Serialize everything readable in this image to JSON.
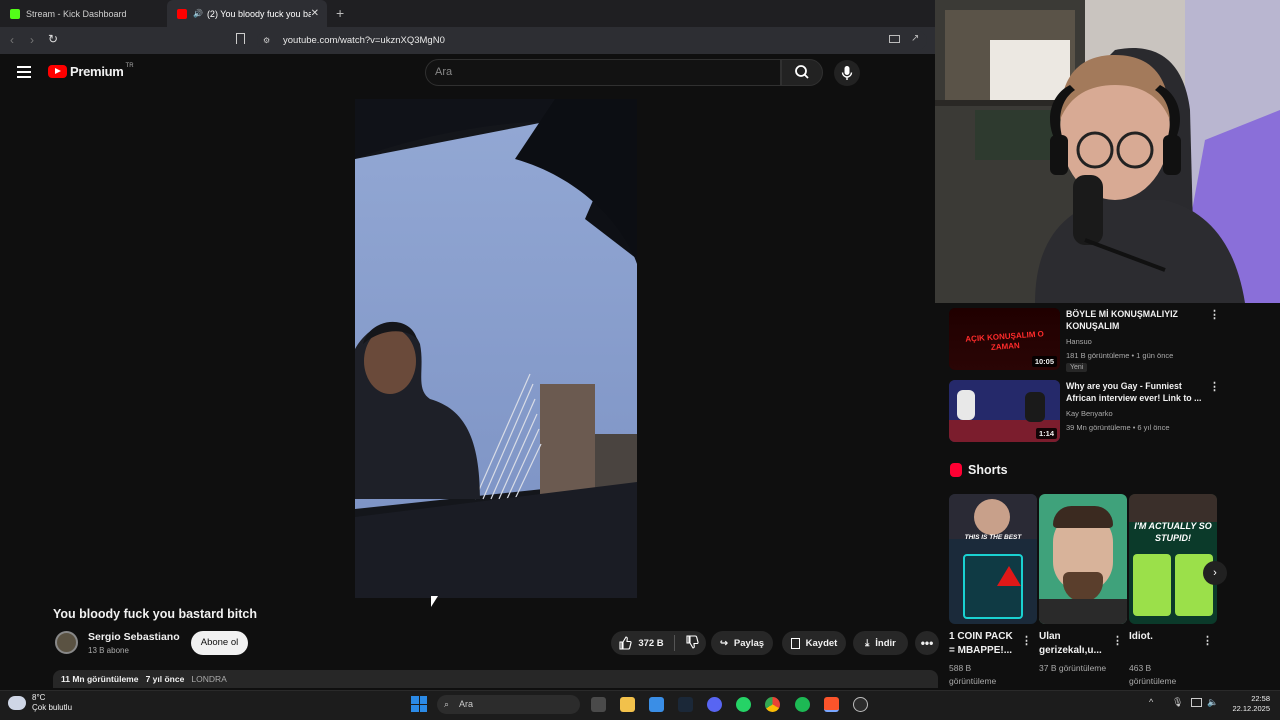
{
  "browser": {
    "tabs": [
      {
        "label": "Stream - Kick Dashboard"
      },
      {
        "label": "(2) You bloody fuck you basta"
      }
    ],
    "url": "youtube.com/watch?v=ukznXQ3MgN0"
  },
  "header": {
    "logo_text": "Premium",
    "region": "TR",
    "search_placeholder": "Ara"
  },
  "video": {
    "title": "You bloody fuck you bastard bitch",
    "channel_name": "Sergio Sebastiano",
    "subscribers": "13 B abone",
    "subscribe_label": "Abone ol",
    "likes": "372 B",
    "share_label": "Paylaş",
    "save_label": "Kaydet",
    "download_label": "İndir",
    "views": "11 Mn görüntüleme",
    "age": "7 yıl önce",
    "location": "LONDRA"
  },
  "recommendations": [
    {
      "title": "BÖYLE Mİ KONUŞMALIYIZ KONUŞALIM",
      "channel": "Hansuo",
      "meta": "181 B görüntüleme • 1 gün önce",
      "duration": "10:05",
      "badge": "Yeni",
      "thumb_text": "AÇIK KONUŞALIM O ZAMAN"
    },
    {
      "title": "Why are you Gay - Funniest African interview ever! Link to ...",
      "channel": "Kay Benyarko",
      "meta": "39 Mn görüntüleme • 6 yıl önce",
      "duration": "1:14"
    }
  ],
  "shorts": {
    "heading": "Shorts",
    "items": [
      {
        "title": "1 COIN PACK = MBAPPE!...",
        "views": "588 B görüntüleme",
        "thumb_text": "THIS IS THE BEST"
      },
      {
        "title": "Ulan gerizekalı,u...",
        "views": "37 B görüntüleme"
      },
      {
        "title": "Idiot.",
        "views": "463 B görüntüleme",
        "thumb_text": "I'M ACTUALLY SO STUPID!"
      }
    ]
  },
  "taskbar": {
    "temperature": "8°C",
    "condition": "Çok bulutlu",
    "search_label": "Ara",
    "time": "22:58",
    "date": "22.12.2025"
  },
  "colors": {
    "youtube_red": "#ff0000",
    "bg": "#0f0f0f",
    "pill": "#272727"
  }
}
